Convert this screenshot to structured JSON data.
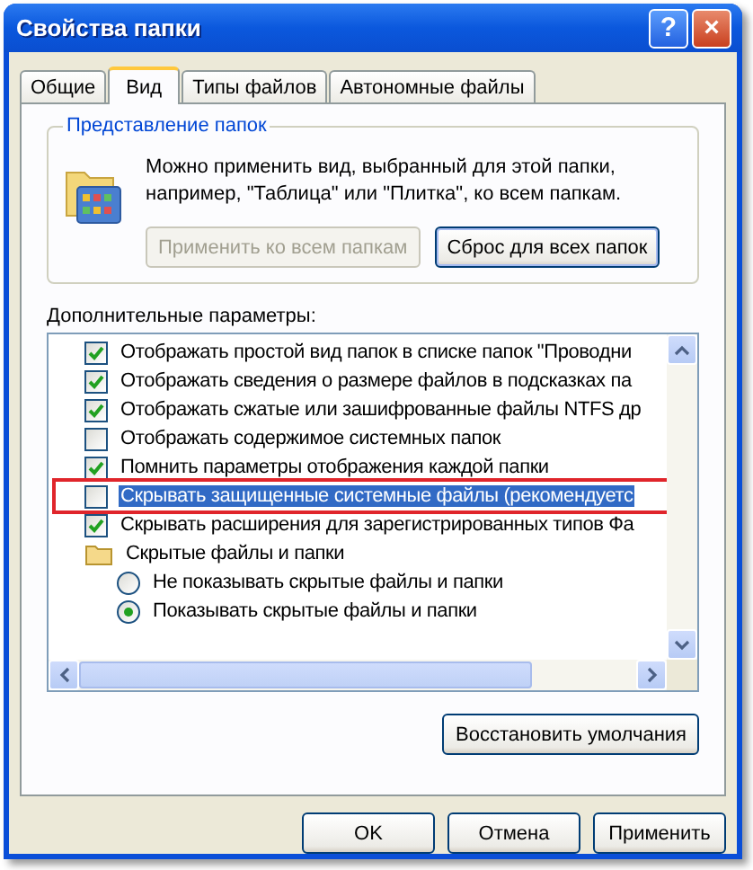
{
  "window": {
    "title": "Свойства папки"
  },
  "title_buttons": [
    {
      "kind": "help",
      "label": "?"
    },
    {
      "kind": "close",
      "label": "×"
    }
  ],
  "tabs": [
    {
      "label": "Общие",
      "selected": false
    },
    {
      "label": "Вид",
      "selected": true
    },
    {
      "label": "Типы файлов",
      "selected": false
    },
    {
      "label": "Автономные файлы",
      "selected": false
    }
  ],
  "folder_views": {
    "title": "Представление папок",
    "description": "Можно применить вид, выбранный для этой папки, например, \"Таблица\" или \"Плитка\", ко всем папкам.",
    "buttons": [
      {
        "label": "Применить ко всем папкам",
        "disabled": true
      },
      {
        "label": "Сброс для всех папок",
        "disabled": false
      }
    ]
  },
  "advanced": {
    "label": "Дополнительные параметры:",
    "items": [
      {
        "kind": "checkbox",
        "label": "Отображать простой вид папок в списке папок \"Проводни",
        "checked": true,
        "selected": false,
        "highlighted": false
      },
      {
        "kind": "checkbox",
        "label": "Отображать сведения о размере файлов в подсказках па",
        "checked": true,
        "selected": false,
        "highlighted": false
      },
      {
        "kind": "checkbox",
        "label": "Отображать сжатые или зашифрованные файлы NTFS др",
        "checked": true,
        "selected": false,
        "highlighted": false
      },
      {
        "kind": "checkbox",
        "label": "Отображать содержимое системных папок",
        "checked": false,
        "selected": false,
        "highlighted": false
      },
      {
        "kind": "checkbox",
        "label": "Помнить параметры отображения каждой папки",
        "checked": true,
        "selected": false,
        "highlighted": false
      },
      {
        "kind": "checkbox",
        "label": "Скрывать защищенные системные файлы (рекомендуетс",
        "checked": false,
        "selected": true,
        "highlighted": true
      },
      {
        "kind": "checkbox",
        "label": "Скрывать расширения для зарегистрированных типов Фа",
        "checked": true,
        "selected": false,
        "highlighted": false
      },
      {
        "kind": "folder",
        "label": "Скрытые файлы и папки",
        "children": [
          {
            "kind": "radio",
            "label": "Не показывать скрытые файлы и папки",
            "selected": false
          },
          {
            "kind": "radio",
            "label": "Показывать скрытые файлы и папки",
            "selected": true
          }
        ]
      }
    ],
    "restore_button": "Восстановить умолчания"
  },
  "buttons": [
    "OK",
    "Отмена",
    "Применить"
  ]
}
